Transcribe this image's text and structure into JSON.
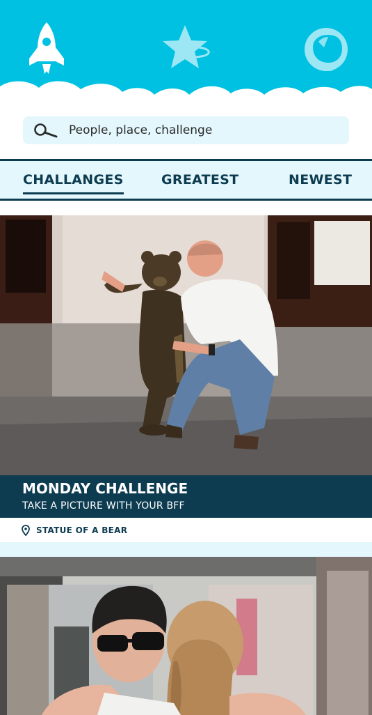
{
  "header": {
    "nav": [
      {
        "icon": "rocket-icon"
      },
      {
        "icon": "star-icon"
      },
      {
        "icon": "astronaut-helmet-icon"
      }
    ],
    "colors": {
      "sky": "#00c1e1",
      "cloud": "#ffffff",
      "icon_light": "#9de7f5"
    }
  },
  "search": {
    "placeholder": "People, place, challenge",
    "value": ""
  },
  "tabs": [
    {
      "label": "CHALLANGES",
      "active": true
    },
    {
      "label": "GREATEST",
      "active": false
    },
    {
      "label": "NEWEST",
      "active": false
    }
  ],
  "feed": [
    {
      "image": "photo-man-with-bear-statue",
      "title": "MONDAY CHALLENGE",
      "subtitle": "TAKE A PICTURE WITH YOUR BFF",
      "location": "STATUE OF A BEAR"
    },
    {
      "image": "photo-friends-hugging"
    }
  ],
  "colors": {
    "navy": "#0d3b50",
    "light_blue": "#e3f7fc"
  }
}
